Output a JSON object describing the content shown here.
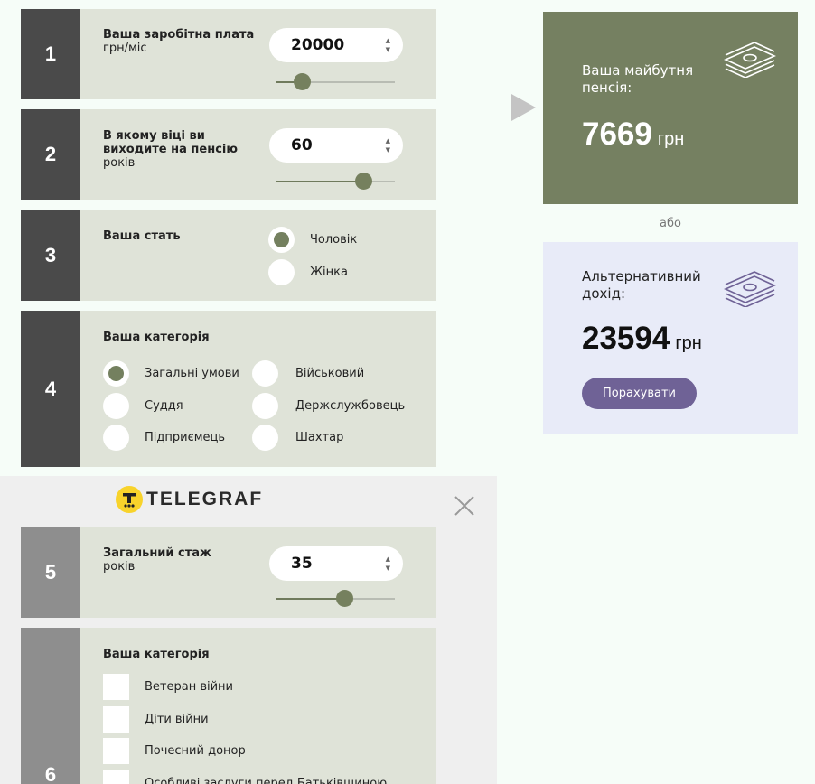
{
  "colors": {
    "step_bg": "#dfe3d8",
    "step_num_dark": "#4a4a4a",
    "step_num_light": "#8e8e8e",
    "accent_green": "#758061",
    "card_lavender": "#e8ebf8",
    "button_purple": "#6f6296"
  },
  "steps": [
    {
      "num": "1",
      "title": "Ваша заробітна плата",
      "sub": "грн/міс",
      "value": "20000",
      "slider_fraction": 0.22
    },
    {
      "num": "2",
      "title": "В якому віці ви виходите на пенсію",
      "sub": "років",
      "value": "60",
      "slider_fraction": 0.74
    },
    {
      "num": "3",
      "title": "Ваша стать",
      "options": [
        {
          "label": "Чоловік",
          "selected": true
        },
        {
          "label": "Жінка",
          "selected": false
        }
      ]
    },
    {
      "num": "4",
      "title": "Ваша категорія",
      "options": [
        {
          "label": "Загальні умови",
          "selected": true
        },
        {
          "label": "Військовий",
          "selected": false
        },
        {
          "label": "Суддя",
          "selected": false
        },
        {
          "label": "Держслужбовець",
          "selected": false
        },
        {
          "label": "Підприємець",
          "selected": false
        },
        {
          "label": "Шахтар",
          "selected": false
        }
      ]
    },
    {
      "num": "5",
      "title": "Загальний стаж",
      "sub": "років",
      "value": "35",
      "slider_fraction": 0.58
    },
    {
      "num": "6",
      "title": "Ваша категорія",
      "checkboxes": [
        {
          "label": "Ветеран війни",
          "checked": false
        },
        {
          "label": "Діти війни",
          "checked": false
        },
        {
          "label": "Почесний донор",
          "checked": false
        },
        {
          "label": "Особливі заслуги перед Батьківщиною",
          "checked": false
        }
      ]
    }
  ],
  "result": {
    "pension_label": "Ваша майбутня пенсія:",
    "pension_value": "7669",
    "pension_unit": "грн",
    "or_label": "або",
    "alt_label": "Альтернативний дохід:",
    "alt_value": "23594",
    "alt_unit": "грн",
    "calc_button": "Порахувати",
    "icon": "money-stack-icon"
  },
  "overlay": {
    "logo_text": "TELEGRAF",
    "close_icon": "close-icon"
  }
}
